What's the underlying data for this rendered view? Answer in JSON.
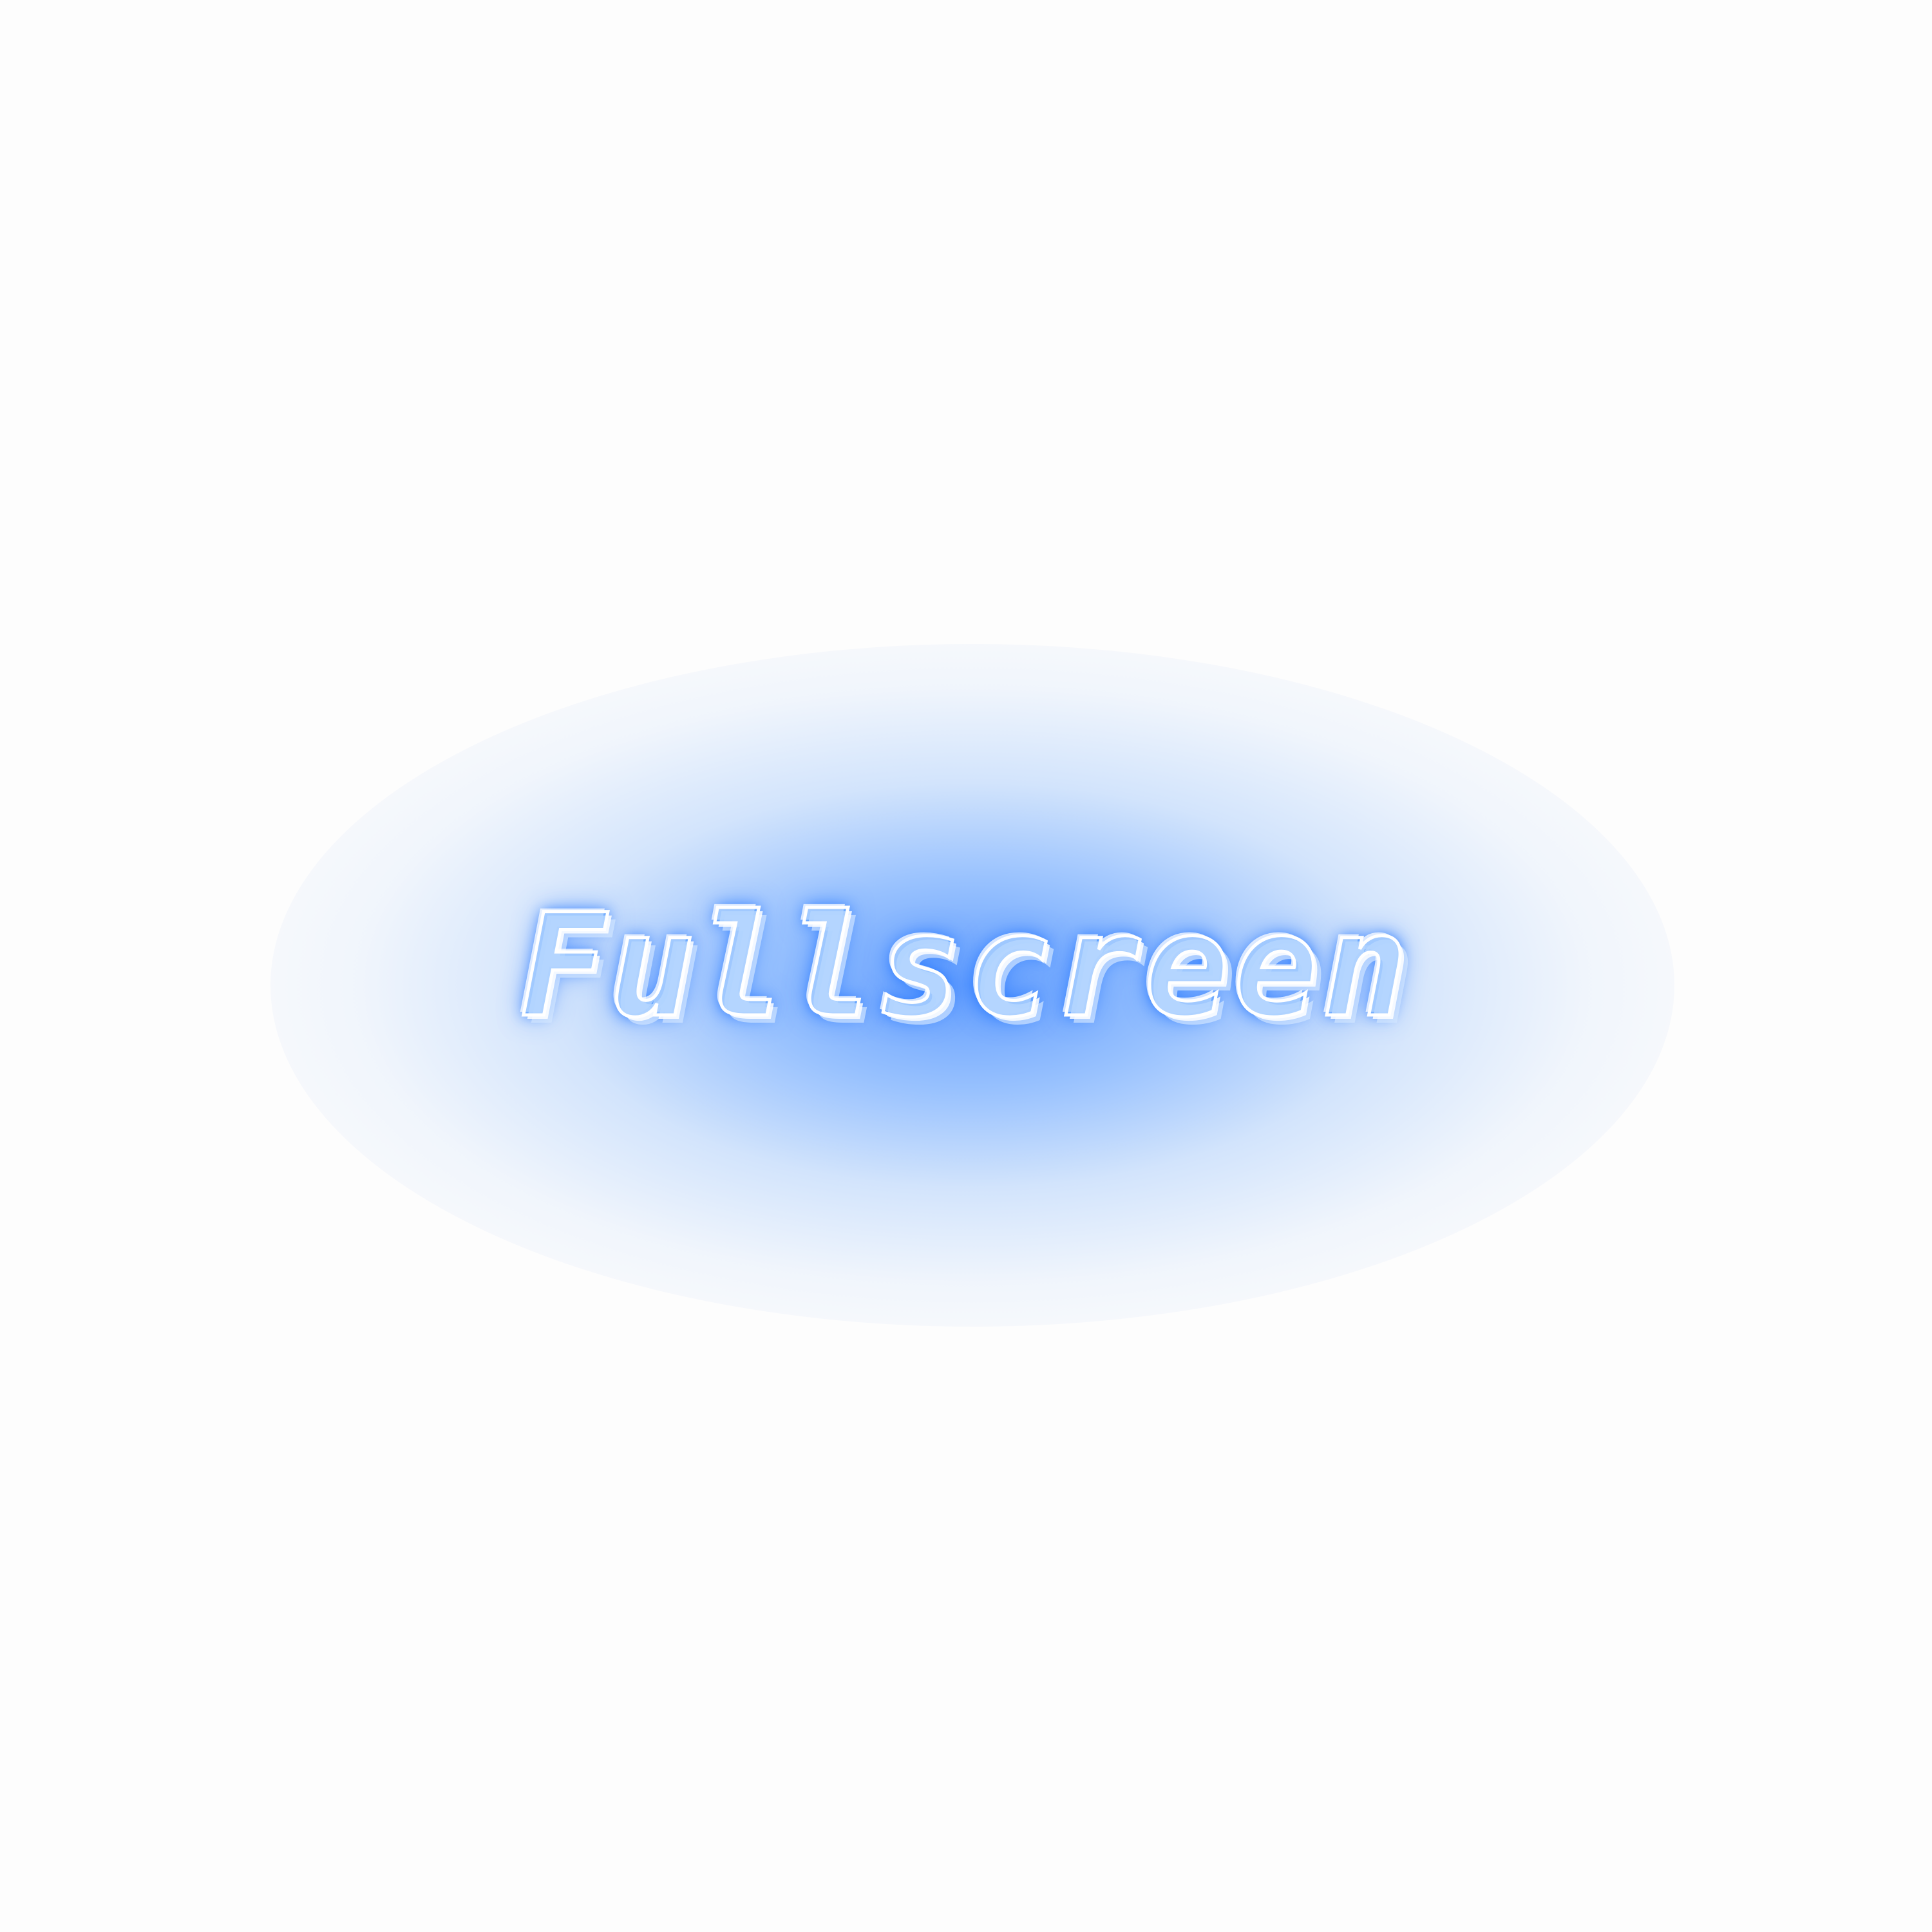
{
  "screen": {
    "label": "Fullscreen"
  },
  "colors": {
    "background": "#fdfdfd",
    "glow": "#2578ff",
    "text_outline": "#ffffff"
  }
}
